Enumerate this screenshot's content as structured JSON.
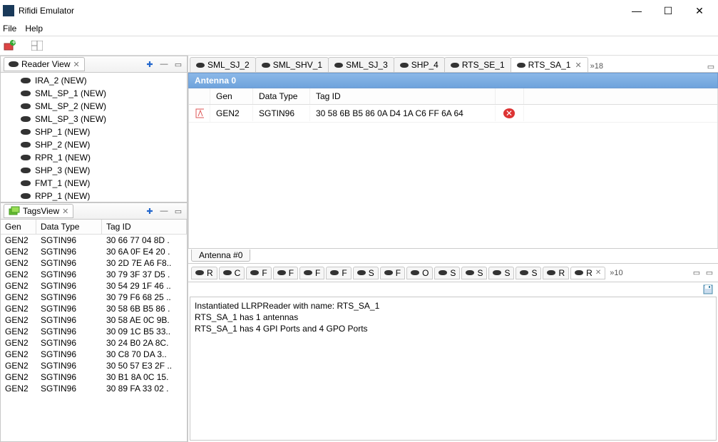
{
  "window": {
    "title": "Rifidi Emulator"
  },
  "menu": {
    "file": "File",
    "help": "Help"
  },
  "readerView": {
    "title": "Reader View",
    "items": [
      "IRA_2 (NEW)",
      "SML_SP_1 (NEW)",
      "SML_SP_2 (NEW)",
      "SML_SP_3 (NEW)",
      "SHP_1 (NEW)",
      "SHP_2 (NEW)",
      "RPR_1 (NEW)",
      "SHP_3 (NEW)",
      "FMT_1 (NEW)",
      "RPP_1 (NEW)"
    ]
  },
  "tagsView": {
    "title": "TagsView",
    "columns": {
      "gen": "Gen",
      "dataType": "Data Type",
      "tagId": "Tag ID"
    },
    "rows": [
      {
        "gen": "GEN2",
        "dt": "SGTIN96",
        "id": "30 66 77 04 8D ."
      },
      {
        "gen": "GEN2",
        "dt": "SGTIN96",
        "id": "30 6A 0F E4 20 ."
      },
      {
        "gen": "GEN2",
        "dt": "SGTIN96",
        "id": "30 2D 7E A6 F8.."
      },
      {
        "gen": "GEN2",
        "dt": "SGTIN96",
        "id": "30 79 3F 37 D5 ."
      },
      {
        "gen": "GEN2",
        "dt": "SGTIN96",
        "id": "30 54 29 1F 46 .."
      },
      {
        "gen": "GEN2",
        "dt": "SGTIN96",
        "id": "30 79 F6 68 25 .."
      },
      {
        "gen": "GEN2",
        "dt": "SGTIN96",
        "id": "30 58 6B B5 86 ."
      },
      {
        "gen": "GEN2",
        "dt": "SGTIN96",
        "id": "30 58 AE 0C 9B."
      },
      {
        "gen": "GEN2",
        "dt": "SGTIN96",
        "id": "30 09 1C B5 33.."
      },
      {
        "gen": "GEN2",
        "dt": "SGTIN96",
        "id": "30 24 B0 2A 8C."
      },
      {
        "gen": "GEN2",
        "dt": "SGTIN96",
        "id": "30 C8 70 DA 3.."
      },
      {
        "gen": "GEN2",
        "dt": "SGTIN96",
        "id": "30 50 57 E3 2F .."
      },
      {
        "gen": "GEN2",
        "dt": "SGTIN96",
        "id": "30 B1 8A 0C 15."
      },
      {
        "gen": "GEN2",
        "dt": "SGTIN96",
        "id": "30 89 FA 33 02 ."
      }
    ]
  },
  "editor": {
    "tabs": [
      "SML_SJ_2",
      "SML_SHV_1",
      "SML_SJ_3",
      "SHP_4",
      "RTS_SE_1",
      "RTS_SA_1"
    ],
    "activeIndex": 5,
    "overflow": "»18"
  },
  "antenna": {
    "header": "Antenna 0",
    "columns": {
      "gen": "Gen",
      "dataType": "Data Type",
      "tagId": "Tag ID"
    },
    "rows": [
      {
        "gen": "GEN2",
        "dt": "SGTIN96",
        "id": "30 58 6B B5 86 0A D4 1A C6 FF 6A 64"
      }
    ],
    "bottomTab": "Antenna #0"
  },
  "ports": {
    "tabs": [
      "R",
      "C",
      "F",
      "F",
      "F",
      "F",
      "S",
      "F",
      "O",
      "S",
      "S",
      "S",
      "S",
      "R",
      "R"
    ],
    "activeIndex": 14,
    "overflow": "»10"
  },
  "console": {
    "lines": [
      "Instantiated LLRPReader with name: RTS_SA_1",
      "RTS_SA_1 has 1 antennas",
      "RTS_SA_1 has 4 GPI Ports and 4 GPO Ports"
    ]
  }
}
